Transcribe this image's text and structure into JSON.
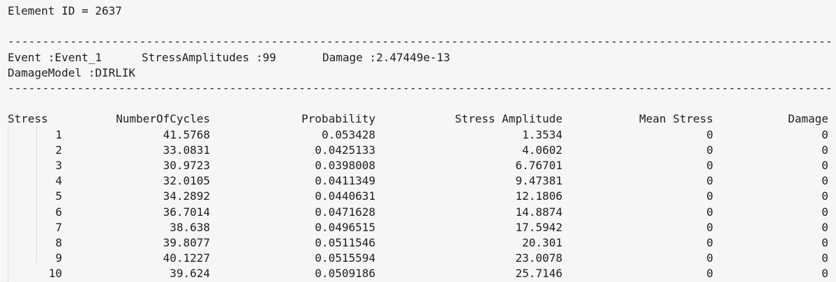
{
  "colors": {
    "background": "#f6f6f6",
    "text": "#1e1e1e",
    "indent_guide": "#c6c6c6"
  },
  "header": {
    "element_id_line": "Element ID = 2637",
    "separator": "--------------------------------------------------------------------------------------------------------------------------",
    "event_name": "Event :Event_1",
    "stress_amplitudes": "StressAmplitudes :99",
    "event_damage": "Damage :2.47449e-13",
    "damage_model": "DamageModel :DIRLIK"
  },
  "table": {
    "headers": [
      "Stress",
      "NumberOfCycles",
      "Probability",
      "Stress Amplitude",
      "Mean Stress",
      "Damage"
    ],
    "rows": [
      [
        "1",
        "41.5768",
        "0.053428",
        "1.3534",
        "0",
        "0"
      ],
      [
        "2",
        "33.0831",
        "0.0425133",
        "4.0602",
        "0",
        "0"
      ],
      [
        "3",
        "30.9723",
        "0.0398008",
        "6.76701",
        "0",
        "0"
      ],
      [
        "4",
        "32.0105",
        "0.0411349",
        "9.47381",
        "0",
        "0"
      ],
      [
        "5",
        "34.2892",
        "0.0440631",
        "12.1806",
        "0",
        "0"
      ],
      [
        "6",
        "36.7014",
        "0.0471628",
        "14.8874",
        "0",
        "0"
      ],
      [
        "7",
        "38.638",
        "0.0496515",
        "17.5942",
        "0",
        "0"
      ],
      [
        "8",
        "39.8077",
        "0.0511546",
        "20.301",
        "0",
        "0"
      ],
      [
        "9",
        "40.1227",
        "0.0515594",
        "23.0078",
        "0",
        "0"
      ],
      [
        "10",
        "39.624",
        "0.0509186",
        "25.7146",
        "0",
        "0"
      ]
    ]
  }
}
